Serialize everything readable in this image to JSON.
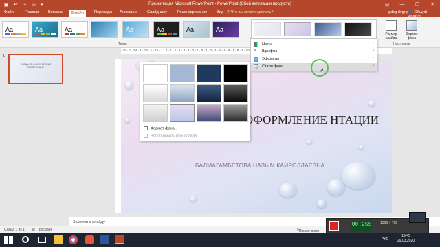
{
  "titlebar": {
    "title": "Презентация Microsoft PowerPoint - PowerPoint (Сбой активации продукта)",
    "controls": [
      "—",
      "❐",
      "✕"
    ]
  },
  "tabs": [
    {
      "label": "Файл"
    },
    {
      "label": "Главная"
    },
    {
      "label": "Вставка"
    },
    {
      "label": "Дизайн"
    },
    {
      "label": "Переходы"
    },
    {
      "label": "Анимация"
    },
    {
      "label": "Слайд-шоу"
    },
    {
      "label": "Рецензирование"
    },
    {
      "label": "Вид"
    }
  ],
  "tell_me": "Что вы хотите сделать?",
  "user": "gdsg dvgrg",
  "share": "Общий доступ",
  "themes_group": {
    "label": "Темы",
    "thumb_text": "Aa"
  },
  "customize_group": {
    "label": "Настроить",
    "slide_size": "Размер слайда",
    "format_bg": "Формат фона"
  },
  "menu": {
    "items": [
      {
        "label": "Цвета",
        "icon": "palette-icon"
      },
      {
        "label": "Шрифты",
        "icon": "font-icon"
      },
      {
        "label": "Эффекты",
        "icon": "effects-icon"
      },
      {
        "label": "Стили фона",
        "icon": "background-icon"
      }
    ],
    "arrow": "›"
  },
  "bg_gallery": {
    "format_bg": "Формат фона...",
    "reset_bg": "Восстановить фон слайда"
  },
  "slide_pane": {
    "number": "1",
    "thumb_text": "СОЗДАНИЕ И ОФОРМЛЕНИЕ ПРЕЗЕНТАЦИИ"
  },
  "ruler_text": "· 16 · 1 · 14 · 1 · 12 · 1 · 10 · 1 · 8 · 1 · 6 · 1 · 4 · 1 · 2 · 1 · 0 · 1 · 2 · 1 · 4 · 1 · 6 · 1 · 8 · 1 · 10 · 1 · 12 · 1 · 14 · 1 · 16 ·",
  "slide": {
    "title": "ОФОРМЛЕНИЕ НТАЦИИ",
    "subtitle": "БАЛМАГАМБЕТОВА НАЗЫМ КАЙРОЛЛАЕВНА"
  },
  "notes_placeholder": "Заметки к слайду",
  "status": {
    "slide_info": "Слайд 1 из 1",
    "language": "русский",
    "notes": "Примечания"
  },
  "recorder": {
    "timer": "00:255",
    "size": "1366 × 768"
  },
  "taskbar": {
    "lang": "РУС",
    "time": "19:45",
    "date": "29.03.2020"
  }
}
